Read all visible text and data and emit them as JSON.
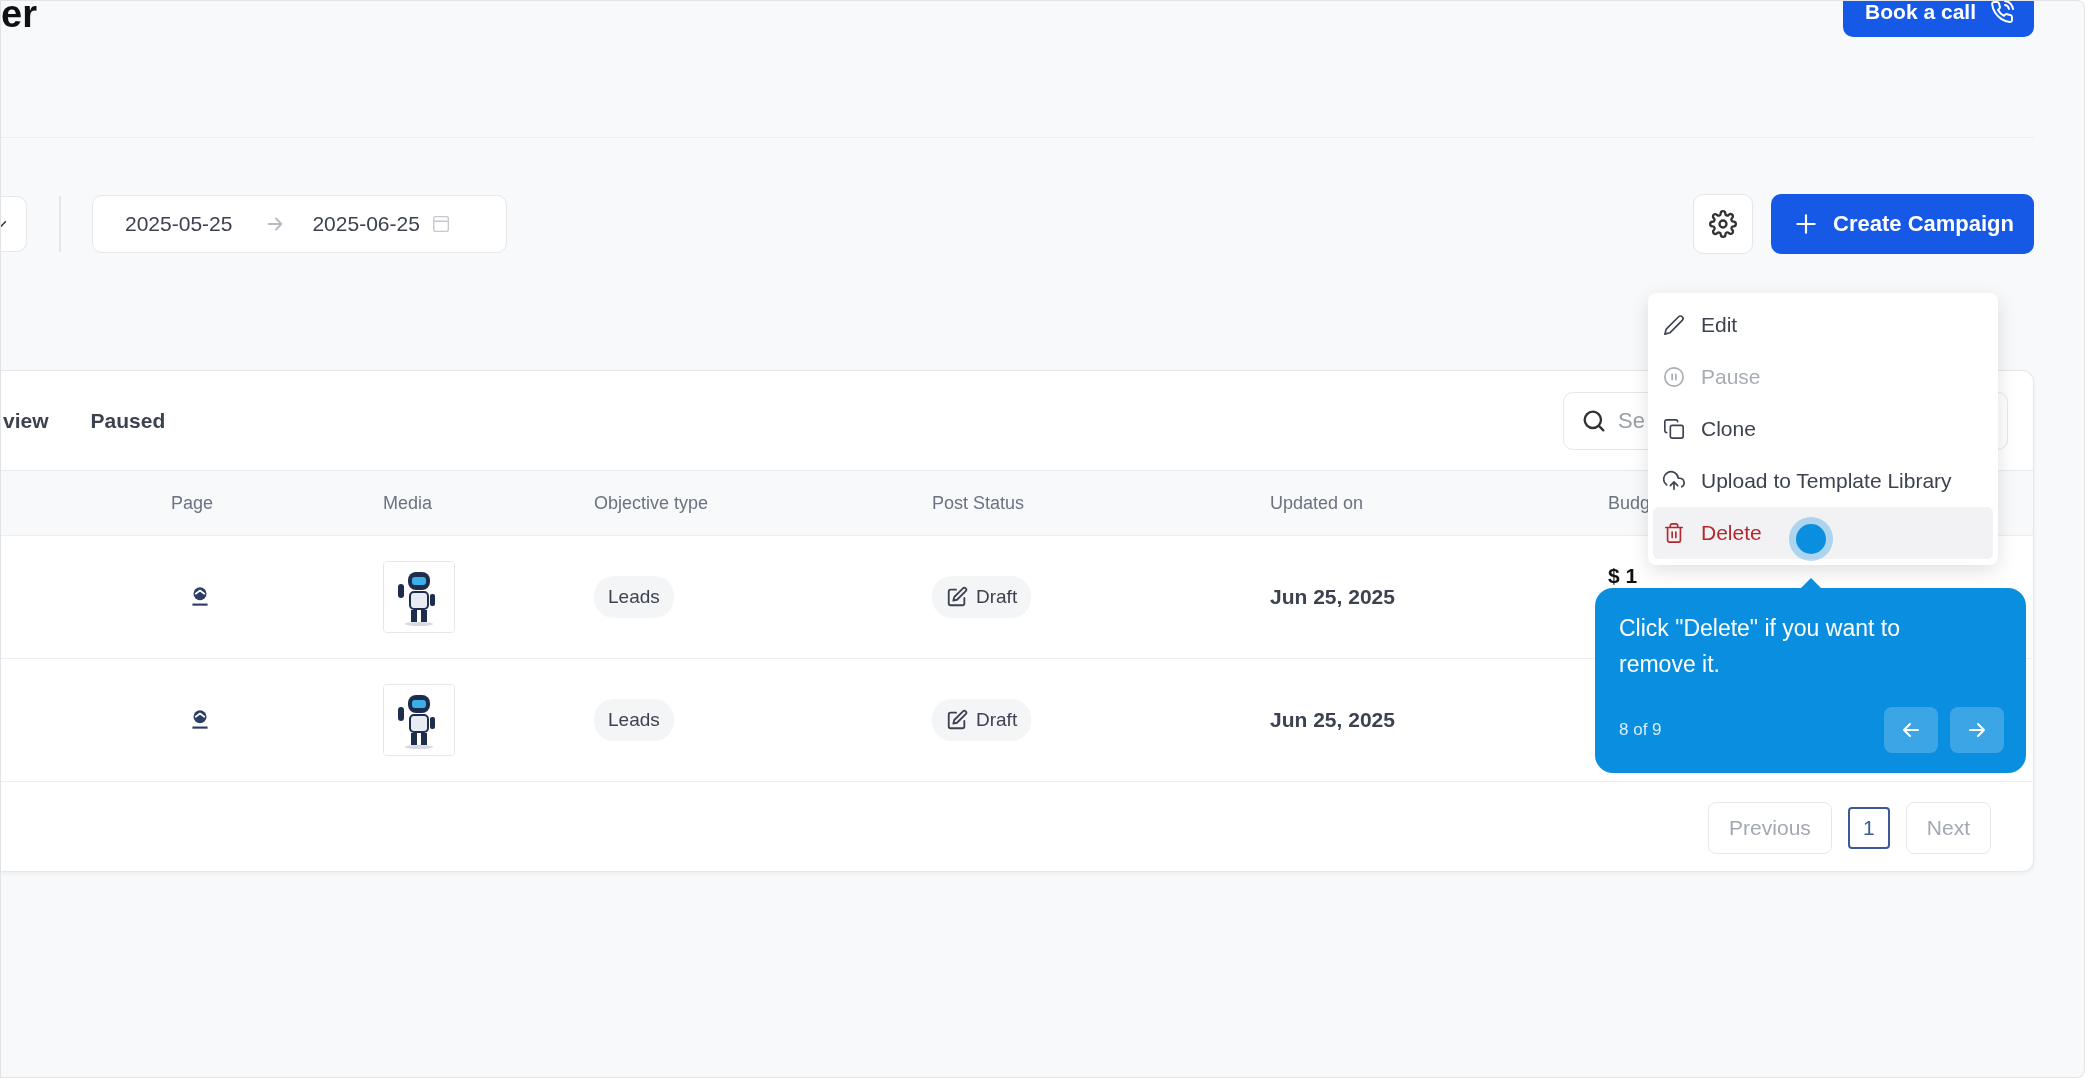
{
  "page_title": "er",
  "book_call": {
    "label": "Book a call"
  },
  "filters": {
    "date_start": "2025-05-25",
    "date_end": "2025-06-25"
  },
  "actions": {
    "create": "Create Campaign"
  },
  "tabs": [
    {
      "label": "view",
      "selected": false
    },
    {
      "label": "Paused",
      "selected": false
    }
  ],
  "search": {
    "placeholder": "Se"
  },
  "table": {
    "columns": [
      "Page",
      "Media",
      "Objective type",
      "Post Status",
      "Updated on",
      "Budg"
    ],
    "rows": [
      {
        "objective": "Leads",
        "status": "Draft",
        "updated": "Jun 25, 2025",
        "budget": "$ 1"
      },
      {
        "objective": "Leads",
        "status": "Draft",
        "updated": "Jun 25, 2025"
      }
    ]
  },
  "pagination": {
    "previous": {
      "label": "Previous",
      "disabled": true
    },
    "pages": [
      {
        "label": "1",
        "selected": true
      }
    ],
    "next": {
      "label": "Next",
      "disabled": true
    }
  },
  "menu": {
    "items": [
      {
        "label": "Edit",
        "kind": "normal",
        "disabled": false,
        "highlighted": false
      },
      {
        "label": "Pause",
        "kind": "normal",
        "disabled": true,
        "highlighted": false
      },
      {
        "label": "Clone",
        "kind": "normal",
        "disabled": false,
        "highlighted": false
      },
      {
        "label": "Upload to Template Library",
        "kind": "normal",
        "disabled": false,
        "highlighted": false
      },
      {
        "label": "Delete",
        "kind": "danger",
        "disabled": false,
        "highlighted": true
      }
    ]
  },
  "tour": {
    "text": "Click \"Delete\" if you want to remove it.",
    "step": "8 of 9"
  }
}
